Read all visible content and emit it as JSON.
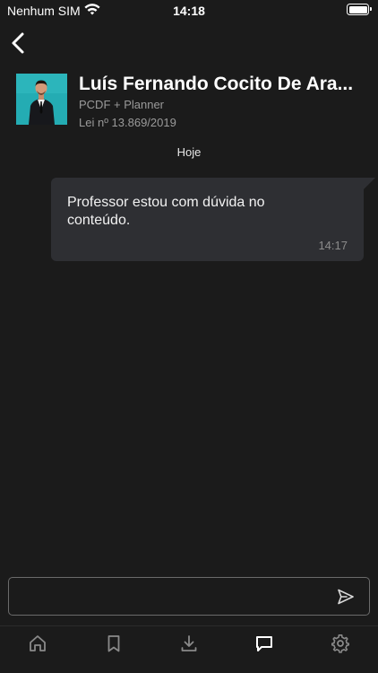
{
  "status_bar": {
    "carrier": "Nenhum SIM",
    "time": "14:18",
    "battery_level": 1.0
  },
  "header": {
    "back_icon": "chevron-left-icon",
    "contact_name": "Luís Fernando Cocito De Ara...",
    "course": "PCDF + Planner",
    "law": "Lei nº 13.869/2019"
  },
  "chat": {
    "date_label": "Hoje",
    "messages": [
      {
        "text": "Professor estou com dúvida no conteúdo.",
        "time": "14:17",
        "direction": "outgoing"
      }
    ]
  },
  "composer": {
    "value": "",
    "placeholder": "",
    "send_icon": "send-icon"
  },
  "tab_bar": {
    "tabs": [
      {
        "icon": "home-icon",
        "active": false
      },
      {
        "icon": "bookmark-icon",
        "active": false
      },
      {
        "icon": "download-icon",
        "active": false
      },
      {
        "icon": "chat-icon",
        "active": true
      },
      {
        "icon": "gear-icon",
        "active": false
      }
    ]
  },
  "colors": {
    "background": "#1b1b1b",
    "bubble": "#2e2f33",
    "muted_text": "#9a9a9a",
    "inactive_icon": "#8a8a8a",
    "active_icon": "#ffffff",
    "avatar_bg": "#23a8b0"
  }
}
